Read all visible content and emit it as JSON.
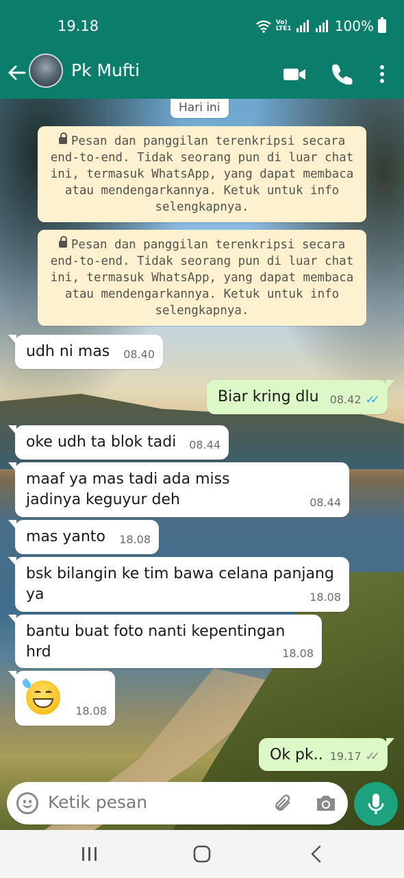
{
  "status_bar": {
    "time": "19.18",
    "network_label": "Vo) LTE1",
    "battery": "100%"
  },
  "header": {
    "contact_name": "Pk Mufti",
    "colors": {
      "bar": "#0b7d6b"
    }
  },
  "chat": {
    "date_chip": "Hari ini",
    "encryption_notices": [
      "Pesan dan panggilan terenkripsi secara end-to-end. Tidak seorang pun di luar chat ini, termasuk WhatsApp, yang dapat membaca atau mendengarkannya. Ketuk untuk info selengkapnya.",
      "Pesan dan panggilan terenkripsi secara end-to-end. Tidak seorang pun di luar chat ini, termasuk WhatsApp, yang dapat membaca atau mendengarkannya. Ketuk untuk info selengkapnya."
    ],
    "messages": [
      {
        "direction": "in",
        "text": "udh ni mas",
        "time": "08.40"
      },
      {
        "direction": "out",
        "text": "Biar kring dlu",
        "time": "08.42",
        "ticks": "read"
      },
      {
        "direction": "in",
        "text": "oke udh ta blok tadi",
        "time": "08.44"
      },
      {
        "direction": "in",
        "text": "maaf ya mas tadi ada miss jadinya keguyur deh",
        "time": "08.44"
      },
      {
        "direction": "in",
        "text": "mas yanto",
        "time": "18.08"
      },
      {
        "direction": "in",
        "text": "bsk bilangin ke tim bawa celana panjang ya",
        "time": "18.08"
      },
      {
        "direction": "in",
        "text": "bantu buat foto nanti kepentingan hrd",
        "time": "18.08"
      },
      {
        "direction": "in",
        "text": "",
        "emoji": "grinning-face-with-sweat",
        "time": "18.08"
      },
      {
        "direction": "out",
        "text": "Ok pk..",
        "time": "19.17",
        "ticks": "delivered"
      }
    ]
  },
  "composer": {
    "placeholder": "Ketik pesan"
  }
}
